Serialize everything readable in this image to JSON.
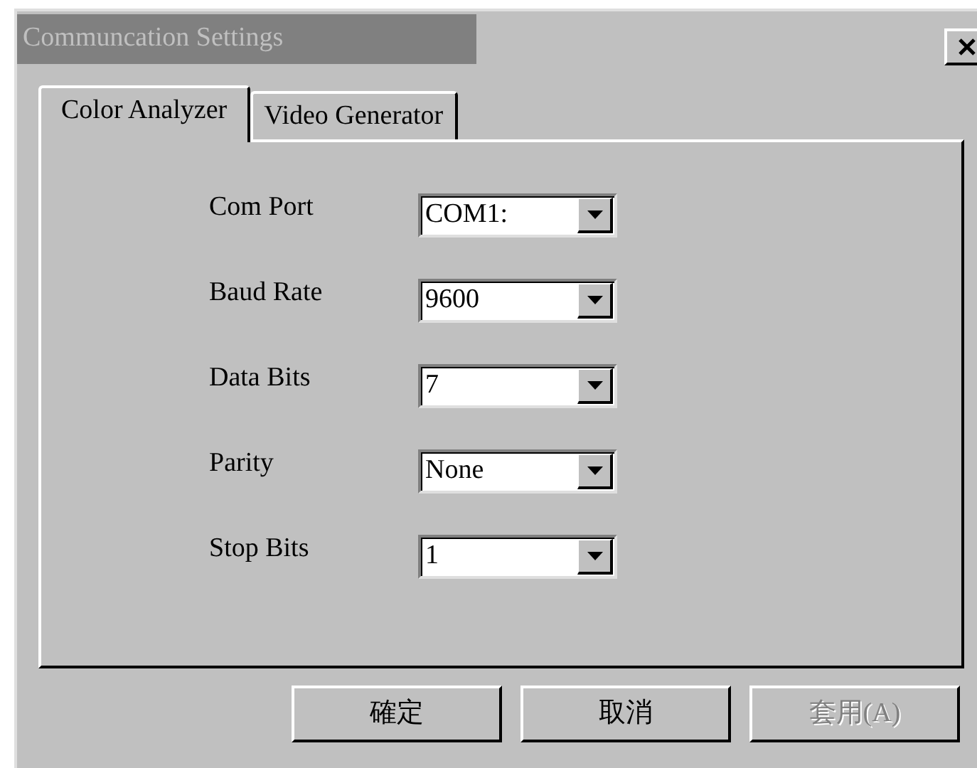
{
  "window": {
    "title": "Communcation Settings",
    "active": false
  },
  "tabs": [
    {
      "label": "Color Analyzer",
      "selected": true
    },
    {
      "label": "Video Generator",
      "selected": false
    }
  ],
  "fields": [
    {
      "label": "Com Port",
      "value": "COM1:"
    },
    {
      "label": "Baud Rate",
      "value": "9600"
    },
    {
      "label": "Data Bits",
      "value": "7"
    },
    {
      "label": "Parity",
      "value": "None"
    },
    {
      "label": "Stop Bits",
      "value": "1"
    }
  ],
  "buttons": [
    {
      "label": "確定",
      "disabled": false
    },
    {
      "label": "取消",
      "disabled": false
    },
    {
      "label": "套用(A)",
      "disabled": true
    }
  ]
}
